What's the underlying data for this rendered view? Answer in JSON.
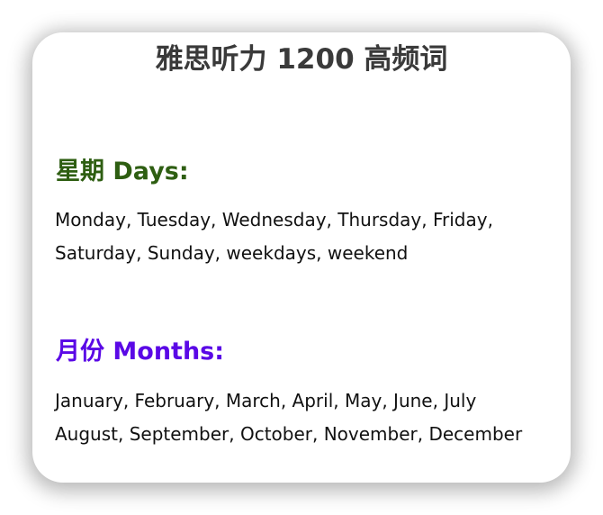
{
  "title": "雅思听力 1200 高频词",
  "sections": {
    "days": {
      "heading": "星期 Days:",
      "lines": [
        "Monday, Tuesday, Wednesday, Thursday, Friday,",
        "Saturday, Sunday, weekdays, weekend"
      ]
    },
    "months": {
      "heading": "月份 Months:",
      "lines": [
        "January, February, March, April, May, June, July",
        "August, September, October, November, December"
      ]
    }
  },
  "colors": {
    "days_heading": "#2e5e12",
    "months_heading": "#5a08e6",
    "title": "#3a3a3a"
  }
}
